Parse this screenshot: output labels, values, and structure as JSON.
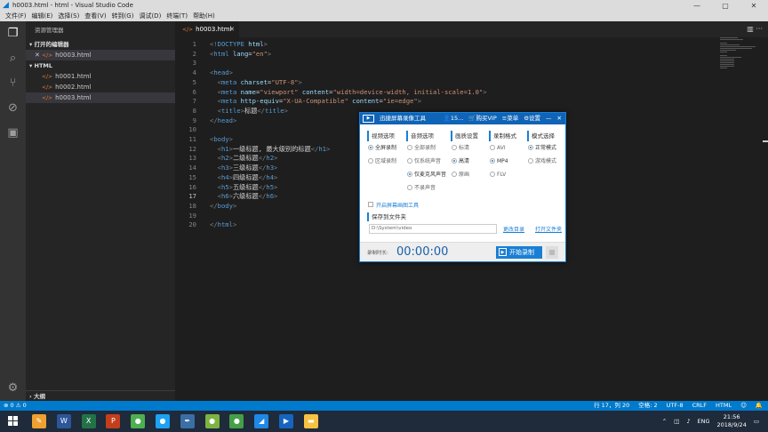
{
  "window": {
    "title": "h0003.html - html - Visual Studio Code",
    "minimize": "—",
    "maximize": "▢",
    "close": "✕"
  },
  "menu": [
    "文件(F)",
    "编辑(E)",
    "选择(S)",
    "查看(V)",
    "转到(G)",
    "调试(D)",
    "终端(T)",
    "帮助(H)"
  ],
  "sidebar": {
    "title": "资源管理器",
    "open_editors": "▾ 打开的编辑器",
    "open_file": "h0003.html",
    "folder": "▾ HTML",
    "files": [
      "h0001.html",
      "h0002.html",
      "h0003.html"
    ],
    "outline": "› 大纲"
  },
  "tab": {
    "label": "h0003.html",
    "close": "✕"
  },
  "editor_actions": "▥ ···",
  "code_lines": [
    {
      "n": "1",
      "parts": [
        [
          "br",
          "<!"
        ],
        [
          "tg",
          "DOCTYPE"
        ],
        [
          "tx",
          " "
        ],
        [
          "at",
          "html"
        ],
        [
          "br",
          ">"
        ]
      ]
    },
    {
      "n": "2",
      "parts": [
        [
          "br",
          "<"
        ],
        [
          "tg",
          "html"
        ],
        [
          "tx",
          " "
        ],
        [
          "at",
          "lang"
        ],
        [
          "tx",
          "="
        ],
        [
          "st",
          "\"en\""
        ],
        [
          "br",
          ">"
        ]
      ]
    },
    {
      "n": "3",
      "parts": []
    },
    {
      "n": "4",
      "parts": [
        [
          "br",
          "<"
        ],
        [
          "tg",
          "head"
        ],
        [
          "br",
          ">"
        ]
      ]
    },
    {
      "n": "5",
      "parts": [
        [
          "tx",
          "  "
        ],
        [
          "br",
          "<"
        ],
        [
          "tg",
          "meta"
        ],
        [
          "tx",
          " "
        ],
        [
          "at",
          "charset"
        ],
        [
          "tx",
          "="
        ],
        [
          "st",
          "\"UTF-8\""
        ],
        [
          "br",
          ">"
        ]
      ]
    },
    {
      "n": "6",
      "parts": [
        [
          "tx",
          "  "
        ],
        [
          "br",
          "<"
        ],
        [
          "tg",
          "meta"
        ],
        [
          "tx",
          " "
        ],
        [
          "at",
          "name"
        ],
        [
          "tx",
          "="
        ],
        [
          "st",
          "\"viewport\""
        ],
        [
          "tx",
          " "
        ],
        [
          "at",
          "content"
        ],
        [
          "tx",
          "="
        ],
        [
          "st",
          "\"width=device-width, initial-scale=1.0\""
        ],
        [
          "br",
          ">"
        ]
      ]
    },
    {
      "n": "7",
      "parts": [
        [
          "tx",
          "  "
        ],
        [
          "br",
          "<"
        ],
        [
          "tg",
          "meta"
        ],
        [
          "tx",
          " "
        ],
        [
          "at",
          "http-equiv"
        ],
        [
          "tx",
          "="
        ],
        [
          "st",
          "\"X-UA-Compatible\""
        ],
        [
          "tx",
          " "
        ],
        [
          "at",
          "content"
        ],
        [
          "tx",
          "="
        ],
        [
          "st",
          "\"ie=edge\""
        ],
        [
          "br",
          ">"
        ]
      ]
    },
    {
      "n": "8",
      "parts": [
        [
          "tx",
          "  "
        ],
        [
          "br",
          "<"
        ],
        [
          "tg",
          "title"
        ],
        [
          "br",
          ">"
        ],
        [
          "tx",
          "标题"
        ],
        [
          "br",
          "</"
        ],
        [
          "tg",
          "title"
        ],
        [
          "br",
          ">"
        ]
      ]
    },
    {
      "n": "9",
      "parts": [
        [
          "br",
          "</"
        ],
        [
          "tg",
          "head"
        ],
        [
          "br",
          ">"
        ]
      ]
    },
    {
      "n": "10",
      "parts": []
    },
    {
      "n": "11",
      "parts": [
        [
          "br",
          "<"
        ],
        [
          "tg",
          "body"
        ],
        [
          "br",
          ">"
        ]
      ]
    },
    {
      "n": "12",
      "parts": [
        [
          "tx",
          "  "
        ],
        [
          "br",
          "<"
        ],
        [
          "tg",
          "h1"
        ],
        [
          "br",
          ">"
        ],
        [
          "tx",
          "一级标题, 最大级别的标题"
        ],
        [
          "br",
          "</"
        ],
        [
          "tg",
          "h1"
        ],
        [
          "br",
          ">"
        ]
      ]
    },
    {
      "n": "13",
      "parts": [
        [
          "tx",
          "  "
        ],
        [
          "br",
          "<"
        ],
        [
          "tg",
          "h2"
        ],
        [
          "br",
          ">"
        ],
        [
          "tx",
          "二级标题"
        ],
        [
          "br",
          "</"
        ],
        [
          "tg",
          "h2"
        ],
        [
          "br",
          ">"
        ]
      ]
    },
    {
      "n": "14",
      "parts": [
        [
          "tx",
          "  "
        ],
        [
          "br",
          "<"
        ],
        [
          "tg",
          "h3"
        ],
        [
          "br",
          ">"
        ],
        [
          "tx",
          "三级标题"
        ],
        [
          "br",
          "</"
        ],
        [
          "tg",
          "h3"
        ],
        [
          "br",
          ">"
        ]
      ]
    },
    {
      "n": "15",
      "parts": [
        [
          "tx",
          "  "
        ],
        [
          "br",
          "<"
        ],
        [
          "tg",
          "h4"
        ],
        [
          "br",
          ">"
        ],
        [
          "tx",
          "四级标题"
        ],
        [
          "br",
          "</"
        ],
        [
          "tg",
          "h4"
        ],
        [
          "br",
          ">"
        ]
      ]
    },
    {
      "n": "16",
      "parts": [
        [
          "tx",
          "  "
        ],
        [
          "br",
          "<"
        ],
        [
          "tg",
          "h5"
        ],
        [
          "br",
          ">"
        ],
        [
          "tx",
          "五级标题"
        ],
        [
          "br",
          "</"
        ],
        [
          "tg",
          "h5"
        ],
        [
          "br",
          ">"
        ]
      ]
    },
    {
      "n": "17",
      "parts": [
        [
          "tx",
          "  "
        ],
        [
          "br",
          "<"
        ],
        [
          "tg",
          "h6"
        ],
        [
          "br",
          ">"
        ],
        [
          "tx",
          "六级标题"
        ],
        [
          "br",
          "</"
        ],
        [
          "tg",
          "h6"
        ],
        [
          "br",
          ">"
        ]
      ]
    },
    {
      "n": "18",
      "parts": [
        [
          "br",
          "</"
        ],
        [
          "tg",
          "body"
        ],
        [
          "br",
          ">"
        ]
      ]
    },
    {
      "n": "19",
      "parts": []
    },
    {
      "n": "20",
      "parts": [
        [
          "br",
          "</"
        ],
        [
          "tg",
          "html"
        ],
        [
          "br",
          ">"
        ]
      ]
    }
  ],
  "current_line": "17",
  "status": {
    "left": "⊗ 0  ⚠ 0",
    "right": [
      "行 17，列 20",
      "空格: 2",
      "UTF-8",
      "CRLF",
      "HTML",
      "☺",
      "🔔"
    ]
  },
  "recorder": {
    "title": "迅捷屏幕录像工具",
    "user": "15...",
    "vip": "购买VIP",
    "menu": "菜单",
    "settings": "设置",
    "columns": [
      {
        "header": "视频选项",
        "options": [
          {
            "label": "全屏录制",
            "on": true
          },
          {
            "label": "区域录制",
            "on": false
          }
        ]
      },
      {
        "header": "音频选项",
        "options": [
          {
            "label": "全部录制",
            "on": false
          },
          {
            "label": "仅系统声音",
            "on": false
          },
          {
            "label": "仅麦克风声音",
            "on": true
          },
          {
            "label": "不录声音",
            "on": false
          }
        ]
      },
      {
        "header": "画质设置",
        "options": [
          {
            "label": "标清",
            "on": false
          },
          {
            "label": "高清",
            "on": true
          },
          {
            "label": "原画",
            "on": false
          }
        ]
      },
      {
        "header": "录制格式",
        "options": [
          {
            "label": "AVI",
            "on": false
          },
          {
            "label": "MP4",
            "on": true
          },
          {
            "label": "FLV",
            "on": false
          }
        ]
      },
      {
        "header": "模式选择",
        "options": [
          {
            "label": "正常模式",
            "on": true
          },
          {
            "label": "游戏模式",
            "on": false
          }
        ]
      }
    ],
    "checkbox": "开启屏幕画图工具",
    "save_header": "保存到文件夹",
    "path": "D:\\System\\video",
    "change_dir": "更改目录",
    "open_dir": "打开文件夹",
    "duration_label": "录制时长:",
    "duration": "00:00:00",
    "start": "开始录制"
  },
  "taskbar": {
    "icons": [
      {
        "name": "paint-app-icon",
        "glyph": "✎",
        "color": "#f0a030"
      },
      {
        "name": "word-icon",
        "glyph": "W",
        "color": "#2b579a"
      },
      {
        "name": "excel-icon",
        "glyph": "X",
        "color": "#217346"
      },
      {
        "name": "powerpoint-icon",
        "glyph": "P",
        "color": "#c43e1c"
      },
      {
        "name": "wechat-icon",
        "glyph": "●",
        "color": "#4caf50"
      },
      {
        "name": "browser-icon",
        "glyph": "●",
        "color": "#1da1f2"
      },
      {
        "name": "pen-tool-icon",
        "glyph": "✒",
        "color": "#3a6ea5"
      },
      {
        "name": "game-icon",
        "glyph": "●",
        "color": "#7cb342"
      },
      {
        "name": "chat-icon",
        "glyph": "●",
        "color": "#43a047"
      },
      {
        "name": "vscode-icon",
        "glyph": "◢",
        "color": "#1e88e5"
      },
      {
        "name": "recorder-taskbar-icon",
        "glyph": "▶",
        "color": "#1565c0"
      },
      {
        "name": "folder-icon",
        "glyph": "▬",
        "color": "#f5c242"
      }
    ],
    "lang": "ENG",
    "time": "21:56",
    "date": "2018/9/24"
  }
}
